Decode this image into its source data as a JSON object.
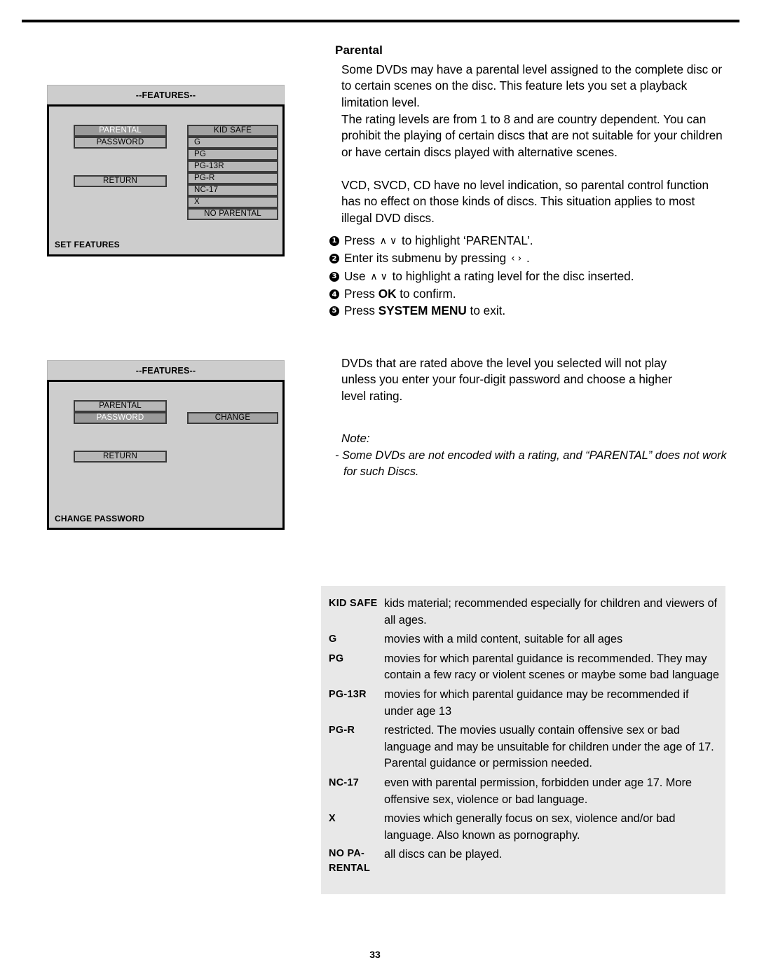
{
  "page": {
    "number": "33"
  },
  "section": {
    "heading": "Parental",
    "paragraph1": "Some DVDs may have a parental level assigned to the complete disc or to certain scenes on the disc. This feature lets you set a playback limitation level.",
    "paragraph2": "The rating levels are from 1 to 8 and are country dependent. You can prohibit the playing of certain discs that are not suitable for your children or have certain discs played with alternative scenes.",
    "paragraph3": "VCD, SVCD, CD have no level indication, so parental control function has no effect on those kinds of discs. This situation applies to most illegal DVD discs.",
    "paragraph4": "DVDs that are rated above the level you selected will not play unless you enter your four-digit password and choose a higher level rating."
  },
  "steps": [
    {
      "num": "1",
      "pre": "Press ",
      "arrows": "up-down",
      "post": " to highlight ‘PARENTAL’."
    },
    {
      "num": "2",
      "pre": "Enter its submenu by pressing ",
      "arrows": "left-right",
      "post": " ."
    },
    {
      "num": "3",
      "pre": "Use ",
      "arrows": "up-down",
      "post": " to highlight a rating level for the disc inserted."
    },
    {
      "num": "4",
      "pre": "Press ",
      "bold": "OK",
      "post": " to confirm."
    },
    {
      "num": "5",
      "pre": "Press ",
      "bold": "SYSTEM MENU",
      "post": " to exit."
    }
  ],
  "note": {
    "label": "Note:",
    "line1": "- Some DVDs are not encoded with a rating, and “PARENTAL”  does not work",
    "line2": "for such Discs."
  },
  "osd_features": {
    "title": "--FEATURES--",
    "footer": "SET FEATURES",
    "left_items": [
      {
        "label": "PARENTAL",
        "selected": true
      },
      {
        "label": "PASSWORD",
        "selected": false
      }
    ],
    "return_label": "RETURN",
    "rating_items": [
      {
        "label": "KID SAFE",
        "highlight": true,
        "align": "center"
      },
      {
        "label": "G",
        "highlight": false,
        "align": "left"
      },
      {
        "label": "PG",
        "highlight": false,
        "align": "left"
      },
      {
        "label": "PG-13R",
        "highlight": false,
        "align": "left"
      },
      {
        "label": "PG-R",
        "highlight": false,
        "align": "left"
      },
      {
        "label": "NC-17",
        "highlight": false,
        "align": "left"
      },
      {
        "label": "X",
        "highlight": false,
        "align": "left"
      },
      {
        "label": "NO PARENTAL",
        "highlight": false,
        "align": "center"
      }
    ]
  },
  "osd_password": {
    "title": "--FEATURES--",
    "footer": "CHANGE PASSWORD",
    "left_items": [
      {
        "label": "PARENTAL",
        "selected": false
      },
      {
        "label": "PASSWORD",
        "selected": true
      }
    ],
    "return_label": "RETURN",
    "change_label": "CHANGE"
  },
  "ratings_table": {
    "rows": [
      {
        "key": "KID SAFE",
        "desc": "kids material; recommended especially for children and viewers of all ages."
      },
      {
        "key": "G",
        "desc": "movies with a mild content, suitable for all ages"
      },
      {
        "key": "PG",
        "desc": "movies for which parental guidance is recommended. They may contain a few racy or violent scenes or maybe some bad language"
      },
      {
        "key": "PG-13R",
        "desc": "movies for which parental guidance may be recommended if under age 13"
      },
      {
        "key": "PG-R",
        "desc": "restricted. The movies usually contain offensive sex or bad language and may be unsuitable for children under the age of 17. Parental guidance or permission needed."
      },
      {
        "key": "NC-17",
        "desc": "even with parental permission, forbidden under age 17. More offensive sex, violence or bad language."
      },
      {
        "key": "X",
        "desc": "movies which generally focus on sex, violence and/or bad language. Also known as pornography."
      },
      {
        "key": "NO PA-\nRENTAL",
        "desc": "all discs can be played."
      }
    ]
  },
  "colors": {
    "osd_background": "#cdcdcd",
    "osd_button": "#b7b7b7",
    "osd_button_selected": "#9a9a9a",
    "table_background": "#e8e8e8"
  }
}
